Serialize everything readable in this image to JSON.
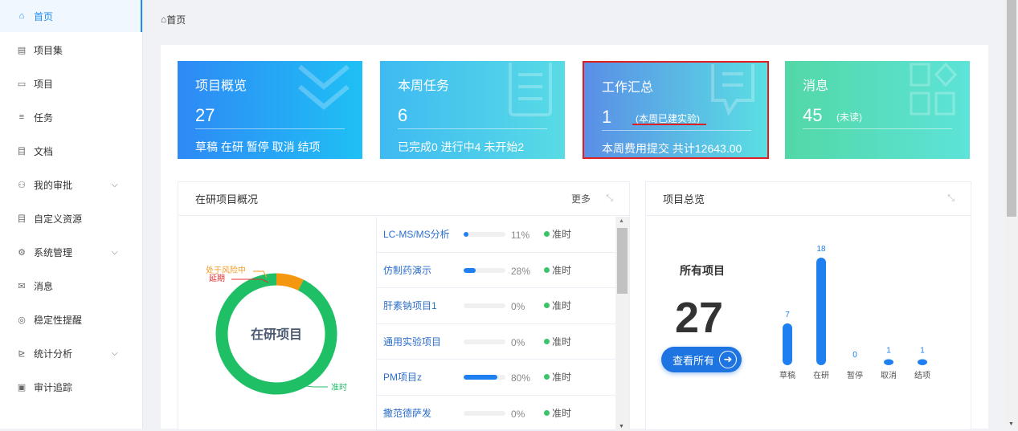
{
  "sidebar": {
    "items": [
      {
        "icon": "home-icon",
        "glyph": "⌂",
        "label": "首页",
        "active": true,
        "chevron": false
      },
      {
        "icon": "project-set-icon",
        "glyph": "▤",
        "label": "项目集",
        "active": false,
        "chevron": false
      },
      {
        "icon": "project-icon",
        "glyph": "▭",
        "label": "项目",
        "active": false,
        "chevron": false
      },
      {
        "icon": "task-list-icon",
        "glyph": "≡",
        "label": "任务",
        "active": false,
        "chevron": false
      },
      {
        "icon": "document-icon",
        "glyph": "目",
        "label": "文档",
        "active": false,
        "chevron": false
      },
      {
        "icon": "approval-icon",
        "glyph": "⚇",
        "label": "我的审批",
        "active": false,
        "chevron": true
      },
      {
        "icon": "custom-resource-icon",
        "glyph": "目",
        "label": "自定义资源",
        "active": false,
        "chevron": false
      },
      {
        "icon": "gear-icon",
        "glyph": "⚙",
        "label": "系统管理",
        "active": false,
        "chevron": true
      },
      {
        "icon": "message-icon",
        "glyph": "✉",
        "label": "消息",
        "active": false,
        "chevron": false
      },
      {
        "icon": "stability-reminder-icon",
        "glyph": "◎",
        "label": "稳定性提醒",
        "active": false,
        "chevron": false
      },
      {
        "icon": "statistics-icon",
        "glyph": "⊵",
        "label": "统计分析",
        "active": false,
        "chevron": true
      },
      {
        "icon": "audit-trail-icon",
        "glyph": "▣",
        "label": "审计追踪",
        "active": false,
        "chevron": false
      }
    ]
  },
  "breadcrumb": {
    "icon": "home-icon",
    "glyph": "⌂",
    "label": "首页"
  },
  "cards": {
    "overview": {
      "title": "项目概览",
      "number": "27",
      "footer": "草稿 在研 暂停 取消 结项"
    },
    "weekly": {
      "title": "本周任务",
      "number": "6",
      "footer": "已完成0  进行中4  未开始2"
    },
    "work": {
      "title": "工作汇总",
      "number": "1",
      "sub": "(本周已建实验)",
      "footer": "本周费用提交 共计12643.00"
    },
    "messages": {
      "title": "消息",
      "number": "45",
      "sub": "(未读)"
    }
  },
  "active_projects": {
    "title": "在研项目概况",
    "more_label": "更多",
    "donut": {
      "center_label": "在研项目",
      "segments": [
        {
          "label": "处于风险中",
          "value": 0,
          "color": "#f59a23"
        },
        {
          "label": "延期",
          "value": 2,
          "color": "#f5960f"
        },
        {
          "label": "准时",
          "value": 25,
          "color": "#1fbf66"
        }
      ],
      "labels": {
        "risk": "处于风险中",
        "delay": "延期",
        "on_time": "准时"
      }
    },
    "rows": [
      {
        "name": "LC-MS/MS分析",
        "progress": 11,
        "pct": "11%",
        "status": "准时"
      },
      {
        "name": "仿制药演示",
        "progress": 28,
        "pct": "28%",
        "status": "准时"
      },
      {
        "name": "肝素钠项目1",
        "progress": 0,
        "pct": "0%",
        "status": "准时"
      },
      {
        "name": "通用实验项目",
        "progress": 0,
        "pct": "0%",
        "status": "准时"
      },
      {
        "name": "PM项目z",
        "progress": 80,
        "pct": "80%",
        "status": "准时"
      },
      {
        "name": "撒范德萨发",
        "progress": 0,
        "pct": "0%",
        "status": "准时"
      }
    ]
  },
  "project_summary": {
    "title": "项目总览",
    "all_label": "所有项目",
    "total": "27",
    "view_all_label": "查看所有",
    "colors": {
      "bar": "#1e7ff0",
      "label": "#1e7ff0"
    }
  },
  "chart_data": {
    "type": "bar",
    "categories": [
      "草稿",
      "在研",
      "暂停",
      "取消",
      "结项"
    ],
    "values": [
      7,
      18,
      0,
      1,
      1
    ],
    "title": "",
    "xlabel": "",
    "ylabel": ""
  }
}
